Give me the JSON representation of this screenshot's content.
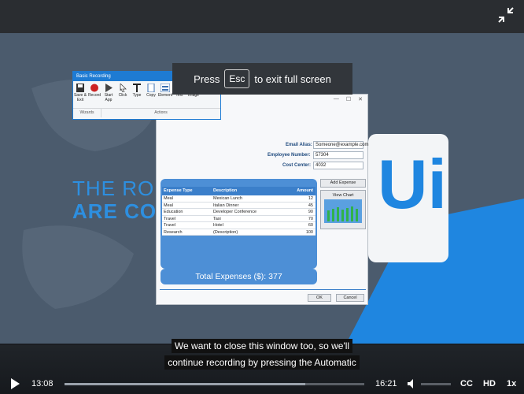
{
  "toast": {
    "press": "Press",
    "key": "Esc",
    "suffix": "to exit full screen"
  },
  "background": {
    "line1": "THE ROB",
    "line2": "ARE COM"
  },
  "recording_window": {
    "title": "Basic Recording",
    "tools": [
      {
        "label": "Save & Exit",
        "icon": "save-icon"
      },
      {
        "label": "Record",
        "icon": "record-icon"
      },
      {
        "label": "Start App",
        "icon": "play-icon"
      },
      {
        "label": "Click",
        "icon": "cursor-icon"
      },
      {
        "label": "Type",
        "icon": "type-icon"
      },
      {
        "label": "Copy",
        "icon": "copy-icon"
      },
      {
        "label": "Element",
        "icon": "element-icon"
      },
      {
        "label": "Text",
        "icon": "text-icon"
      },
      {
        "label": "Image",
        "icon": "image-icon"
      }
    ],
    "groups": [
      "Wizards",
      "Actions"
    ]
  },
  "expense_window": {
    "email_label": "Email Alias:",
    "email_value": "Someone@example.com",
    "emp_label": "Employee Number:",
    "emp_value": "57304",
    "cost_label": "Cost Center:",
    "cost_value": "4032",
    "headers": [
      "Expense Type",
      "Description",
      "Amount"
    ],
    "rows": [
      [
        "Meal",
        "Mexican Lunch",
        "12"
      ],
      [
        "Meal",
        "Italian Dinner",
        "45"
      ],
      [
        "Education",
        "Developer Conference",
        "90"
      ],
      [
        "Travel",
        "Taxi",
        "70"
      ],
      [
        "Travel",
        "Hotel",
        "60"
      ],
      [
        "Research",
        "(Description)",
        "100"
      ]
    ],
    "total": "Total Expenses ($): 377",
    "add_expense": "Add Expense",
    "view_chart": "View Chart",
    "ok": "OK",
    "cancel": "Cancel"
  },
  "logo": "Ui",
  "captions": [
    "We want to close this window too, so we'll",
    "continue recording by pressing the Automatic"
  ],
  "player": {
    "current_time": "13:08",
    "total_time": "16:21",
    "progress": 0.803,
    "cc": "CC",
    "hd": "HD",
    "speed": "1x"
  }
}
